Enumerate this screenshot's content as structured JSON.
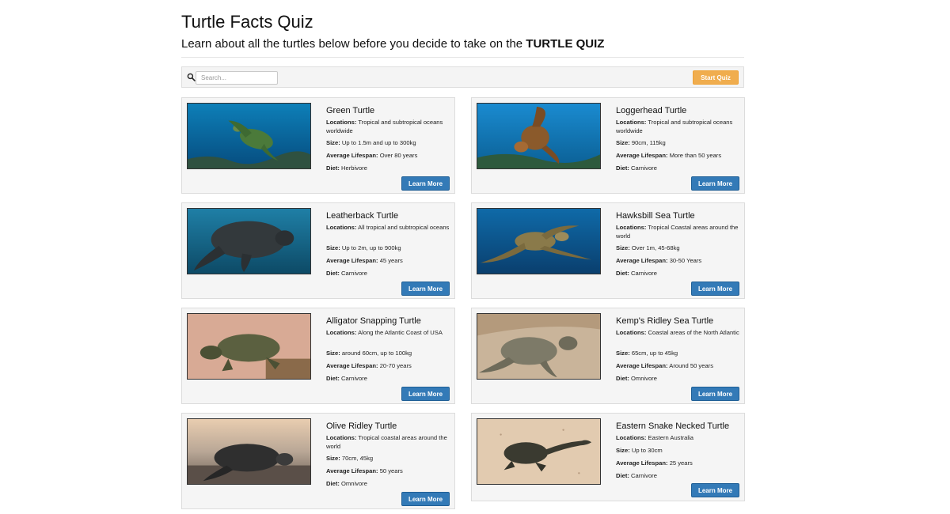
{
  "header": {
    "title": "Turtle Facts Quiz",
    "subtitle_prefix": "Learn about all the turtles below before you decide to take on the ",
    "subtitle_emphasis": "TURTLE QUIZ"
  },
  "toolbar": {
    "search_placeholder": "Search...",
    "search_value": "",
    "search_icon": "search-icon",
    "start_quiz_label": "Start Quiz",
    "start_quiz_color": "#f0ad4e"
  },
  "labels": {
    "locations": "Locations:",
    "size": "Size:",
    "lifespan": "Average Lifespan:",
    "diet": "Diet:"
  },
  "accent_color": "#337ab7",
  "turtles": [
    {
      "name": "Green Turtle",
      "locations": "Tropical and subtropical oceans worldwide",
      "size": "Up to 1.5m and up to 300kg",
      "lifespan": "Over 80 years",
      "diet": "Herbivore",
      "button": "Learn More"
    },
    {
      "name": "Loggerhead Turtle",
      "locations": "Tropical and subtropical oceans worldwide",
      "size": "90cm, 115kg",
      "lifespan": "More than 50 years",
      "diet": "Carnivore",
      "button": "Learn More"
    },
    {
      "name": "Leatherback Turtle",
      "locations": "All tropical and subtropical oceans",
      "size": "Up to 2m, up to 900kg",
      "lifespan": "45 years",
      "diet": "Carnivore",
      "button": "Learn More"
    },
    {
      "name": "Hawksbill Sea Turtle",
      "locations": "Tropical Coastal areas around the world",
      "size": "Over 1m, 45-68kg",
      "lifespan": "30-50 Years",
      "diet": "Carnivore",
      "button": "Learn More"
    },
    {
      "name": "Alligator Snapping Turtle",
      "locations": "Along the Atlantic Coast of USA",
      "size": "around 60cm, up to 100kg",
      "lifespan": "20-70 years",
      "diet": "Carnivore",
      "button": "Learn More"
    },
    {
      "name": "Kemp's Ridley Sea Turtle",
      "locations": "Coastal areas of the North Atlantic",
      "size": "65cm, up to 45kg",
      "lifespan": "Around 50 years",
      "diet": "Omnivore",
      "button": "Learn More"
    },
    {
      "name": "Olive Ridley Turtle",
      "locations": "Tropical coastal areas around the world",
      "size": "70cm, 45kg",
      "lifespan": "50 years",
      "diet": "Omnivore",
      "button": "Learn More"
    },
    {
      "name": "Eastern Snake Necked Turtle",
      "locations": "Eastern Australia",
      "size": "Up to 30cm",
      "lifespan": "25 years",
      "diet": "Carnivore",
      "button": "Learn More"
    }
  ]
}
